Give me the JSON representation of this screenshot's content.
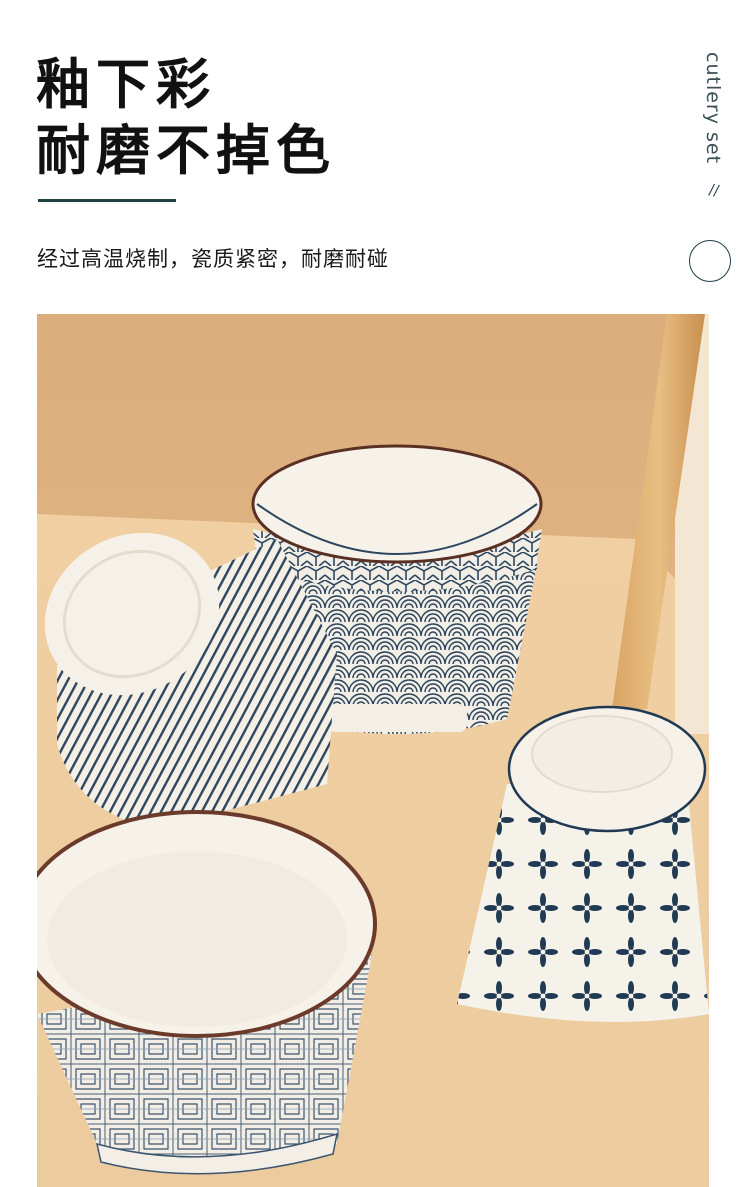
{
  "headline": {
    "line1": "釉下彩",
    "line2": "耐磨不掉色"
  },
  "subtitle": "经过高温烧制，瓷质紧密，耐磨耐碰",
  "side_label": "cutlery set",
  "side_mark": "//",
  "colors": {
    "accent": "#1f4040",
    "background_warm": "#e2b88a",
    "table_top": "#efcc9f",
    "glaze_blue": "#26405a",
    "rim_brown": "#6b3a2a"
  },
  "icons": {
    "decorative_circle": "circle-outline-icon"
  },
  "photo": {
    "subject": "product-photo-bowls"
  }
}
